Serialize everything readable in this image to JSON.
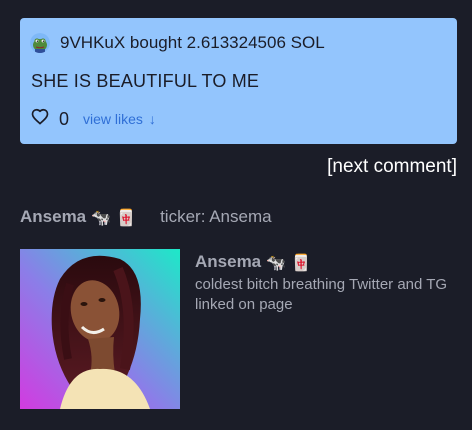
{
  "comment": {
    "user": "9VHKuX",
    "action": "bought",
    "amount": "2.613324506",
    "currency": "SOL",
    "user_line": "9VHKuX bought 2.613324506 SOL",
    "text": "SHE IS BEAUTIFUL TO ME",
    "like_count": "0",
    "view_likes_label": "view likes",
    "view_likes_arrow": "↓",
    "avatar_icon": "pepe-frog-avatar",
    "like_icon": "heart-outline-icon"
  },
  "next_comment_label": "[next comment]",
  "token": {
    "name": "Ansema",
    "emojis": "🐄 🀄",
    "ticker_label": "ticker: Ansema",
    "title": "Ansema",
    "description": "coldest bitch breathing Twitter and TG linked on page",
    "image_icon": "token-portrait-image"
  },
  "colors": {
    "background": "#1b1d28",
    "comment_card": "#93c5fd",
    "link": "#2f6fd6",
    "muted_text": "#a5a8b4",
    "next_comment": "#ffffff"
  }
}
